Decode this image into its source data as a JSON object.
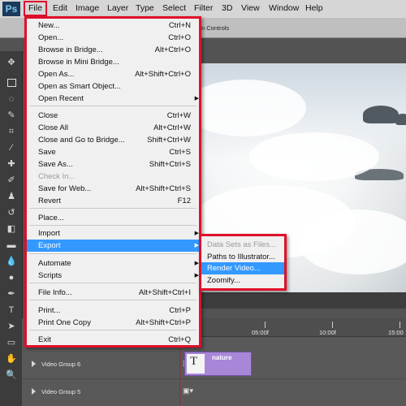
{
  "app": {
    "logo": "Ps"
  },
  "menubar": {
    "items": [
      "File",
      "Edit",
      "Image",
      "Layer",
      "Type",
      "Select",
      "Filter",
      "3D",
      "View",
      "Window",
      "Help"
    ]
  },
  "options_bar": {
    "controls_label": "n Controls"
  },
  "file_menu": {
    "items": [
      {
        "label": "New...",
        "shortcut": "Ctrl+N"
      },
      {
        "label": "Open...",
        "shortcut": "Ctrl+O"
      },
      {
        "label": "Browse in Bridge...",
        "shortcut": "Alt+Ctrl+O"
      },
      {
        "label": "Browse in Mini Bridge...",
        "shortcut": ""
      },
      {
        "label": "Open As...",
        "shortcut": "Alt+Shift+Ctrl+O"
      },
      {
        "label": "Open as Smart Object...",
        "shortcut": ""
      },
      {
        "label": "Open Recent",
        "shortcut": ""
      },
      {
        "label": "Close",
        "shortcut": "Ctrl+W"
      },
      {
        "label": "Close All",
        "shortcut": "Alt+Ctrl+W"
      },
      {
        "label": "Close and Go to Bridge...",
        "shortcut": "Shift+Ctrl+W"
      },
      {
        "label": "Save",
        "shortcut": "Ctrl+S"
      },
      {
        "label": "Save As...",
        "shortcut": "Shift+Ctrl+S"
      },
      {
        "label": "Check In...",
        "shortcut": ""
      },
      {
        "label": "Save for Web...",
        "shortcut": "Alt+Shift+Ctrl+S"
      },
      {
        "label": "Revert",
        "shortcut": "F12"
      },
      {
        "label": "Place...",
        "shortcut": ""
      },
      {
        "label": "Import",
        "shortcut": ""
      },
      {
        "label": "Export",
        "shortcut": ""
      },
      {
        "label": "Automate",
        "shortcut": ""
      },
      {
        "label": "Scripts",
        "shortcut": ""
      },
      {
        "label": "File Info...",
        "shortcut": "Alt+Shift+Ctrl+I"
      },
      {
        "label": "Print...",
        "shortcut": "Ctrl+P"
      },
      {
        "label": "Print One Copy",
        "shortcut": "Alt+Shift+Ctrl+P"
      },
      {
        "label": "Exit",
        "shortcut": "Ctrl+Q"
      }
    ],
    "submenu_arrow": "▶"
  },
  "export_submenu": {
    "items": [
      "Data Sets as Files...",
      "Paths to Illustrator...",
      "Render Video...",
      "Zoomify..."
    ]
  },
  "timeline": {
    "ruler": [
      "05:00f",
      "10:00f",
      "15:00"
    ],
    "tracks": [
      "Video Group 6",
      "Video Group 5"
    ],
    "clip": {
      "name": "nature",
      "thumb_text": "T"
    }
  },
  "colors": {
    "highlight": "#3399ff",
    "annotation_red": "#e0102a",
    "clip": "#a886d8"
  }
}
